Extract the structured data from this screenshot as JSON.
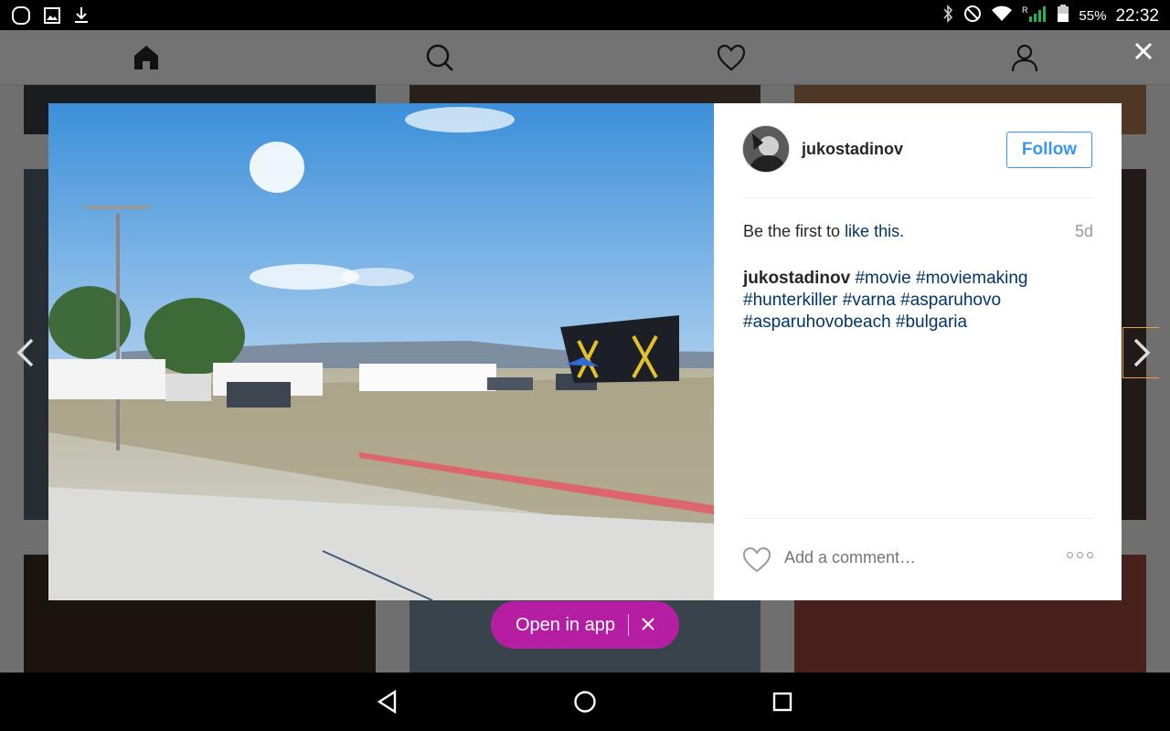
{
  "status_bar": {
    "battery": "55%",
    "time": "22:32",
    "left_icons": [
      "chat-bubble-icon",
      "image-icon",
      "download-icon"
    ],
    "right_icons": [
      "bluetooth-icon",
      "do-not-disturb-icon",
      "wifi-icon",
      "signal-icon",
      "battery-icon"
    ]
  },
  "nav": {
    "icons": [
      "home-icon",
      "search-icon",
      "heart-icon",
      "profile-icon"
    ]
  },
  "open_app": {
    "label": "Open in app"
  },
  "post": {
    "username": "jukostadinov",
    "follow_label": "Follow",
    "likes_prefix": "Be the first to ",
    "likes_link": "like this",
    "likes_suffix": ".",
    "age": "5d",
    "caption": {
      "author": "jukostadinov",
      "hashtags": [
        "#movie",
        "#moviemaking",
        "#hunterkiller",
        "#varna",
        "#asparuhovo",
        "#asparuhovobeach",
        "#bulgaria"
      ]
    },
    "comment_placeholder": "Add a comment…"
  },
  "colors": {
    "accent": "#3897f0",
    "hashtag": "#003569",
    "open_app_bg": "#b51ea3"
  }
}
